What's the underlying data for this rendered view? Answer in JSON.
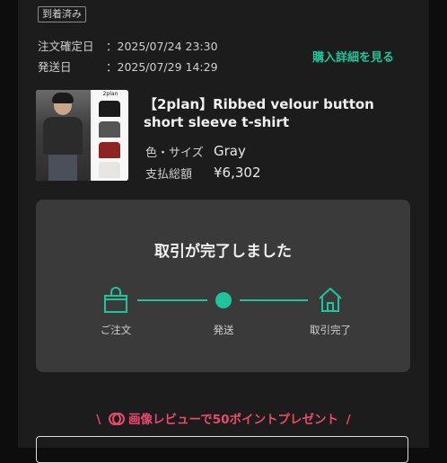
{
  "order": {
    "status_badge": "到着済み",
    "confirmed_label": "注文確定日",
    "confirmed_value": "：2025/07/24 23:30",
    "shipped_label": "発送日",
    "shipped_value": "：2025/07/29 14:29",
    "detail_link": "購入詳細を見る"
  },
  "product": {
    "brand_mark": "2plan",
    "title": "【2plan】Ribbed velour button short sleeve t-shirt",
    "color_size_label": "色・サイズ",
    "color_size_value": "Gray",
    "total_label": "支払総額",
    "total_value": "¥6,302",
    "swatch_colors": [
      "#1a1a1a",
      "#555555",
      "#8e2323",
      "#e8e6e0"
    ]
  },
  "progress": {
    "title": "取引が完了しました",
    "steps": [
      {
        "label": "ご注文",
        "icon": "shopping-bag-icon"
      },
      {
        "label": "発送",
        "icon": "dot-icon"
      },
      {
        "label": "取引完了",
        "icon": "home-icon"
      }
    ],
    "accent": "#1fc49a"
  },
  "promo": {
    "text": "画像レビューで50ポイントプレゼント",
    "color": "#e84a6a"
  }
}
